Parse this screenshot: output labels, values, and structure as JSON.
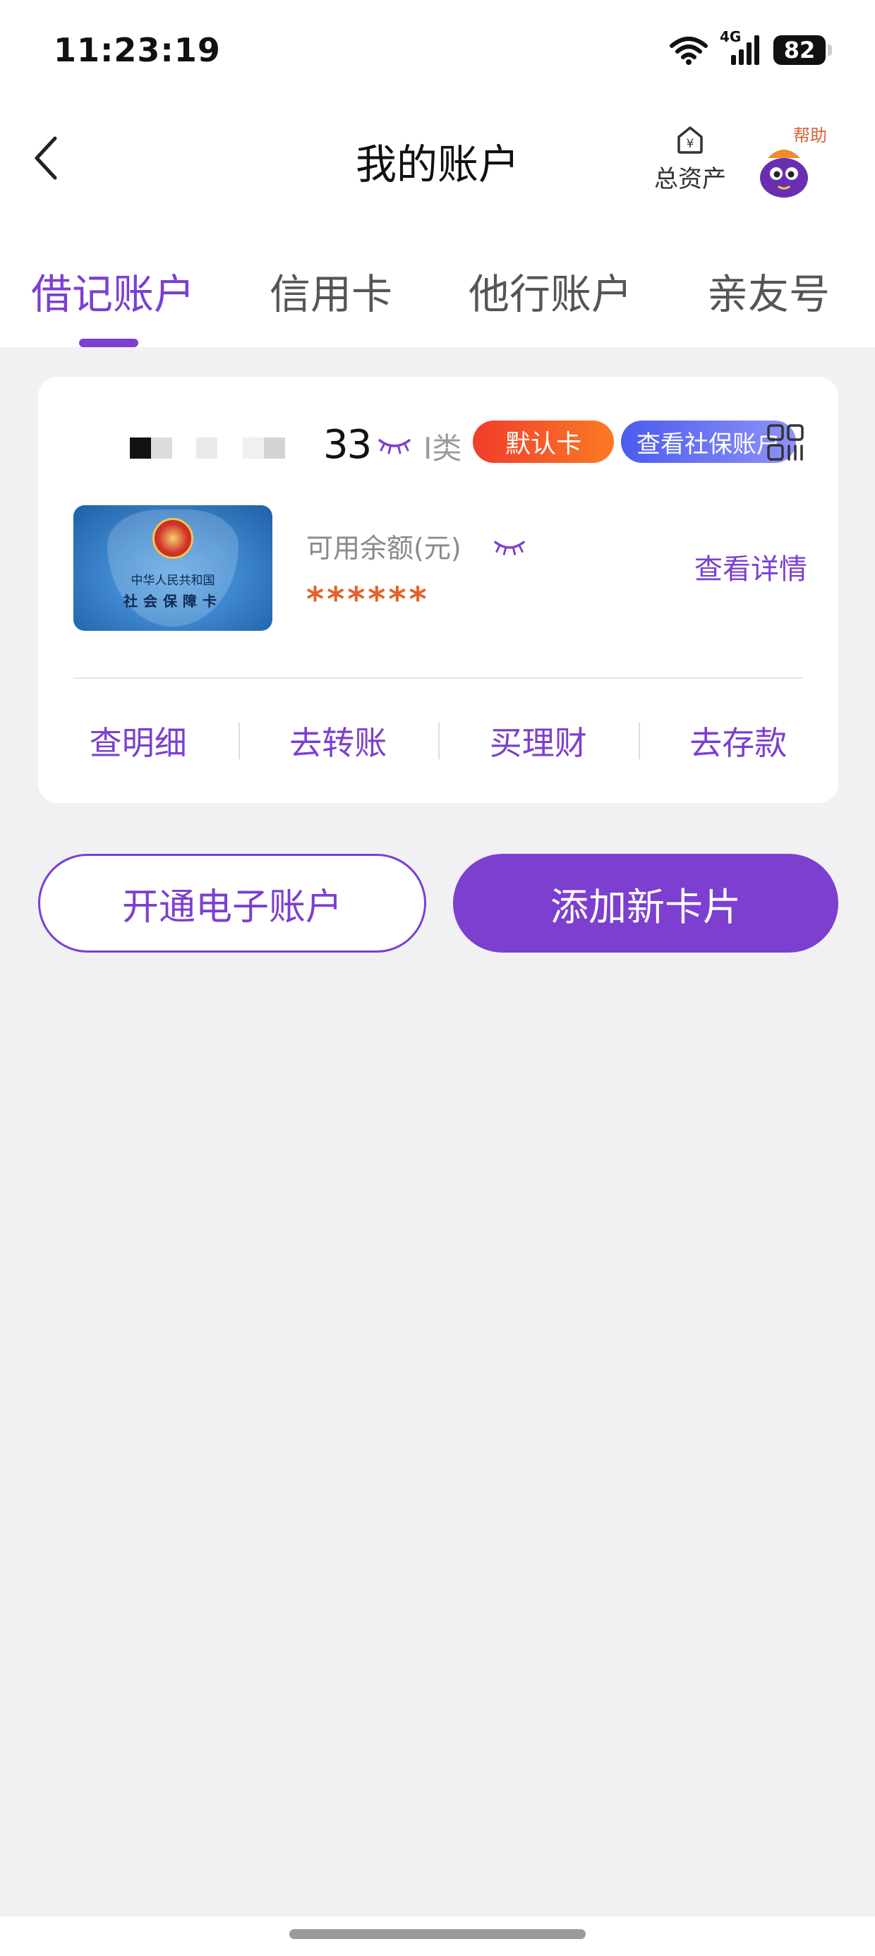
{
  "status_bar": {
    "time": "11:23:19",
    "network": "4G",
    "battery": "82",
    "icons": [
      "wifi-icon",
      "signal-icon",
      "battery-icon"
    ]
  },
  "nav": {
    "back_icon": "chevron-left-icon",
    "title": "我的账户",
    "assets_label": "总资产",
    "assets_icon": "yen-house-icon",
    "help_label": "帮助",
    "help_icon": "mascot-icon"
  },
  "tabs": [
    {
      "label": "借记账户",
      "active": true
    },
    {
      "label": "信用卡",
      "active": false
    },
    {
      "label": "他行账户",
      "active": false
    },
    {
      "label": "亲友号",
      "active": false
    }
  ],
  "account_card": {
    "number_tail": "33",
    "account_class": "I类",
    "badge_default": "默认卡",
    "badge_social": "查看社保账户",
    "card_face_line1": "中华人民共和国",
    "card_face_line2": "社会保障卡",
    "balance_label": "可用余额(元)",
    "balance_value": "******",
    "view_detail": "查看详情",
    "actions": [
      "查明细",
      "去转账",
      "买理财",
      "去存款"
    ]
  },
  "buttons": {
    "open_e_account": "开通电子账户",
    "add_card": "添加新卡片"
  },
  "colors": {
    "accent": "#7c3fd0",
    "balance": "#e2622a",
    "background": "#f1f1f3"
  }
}
